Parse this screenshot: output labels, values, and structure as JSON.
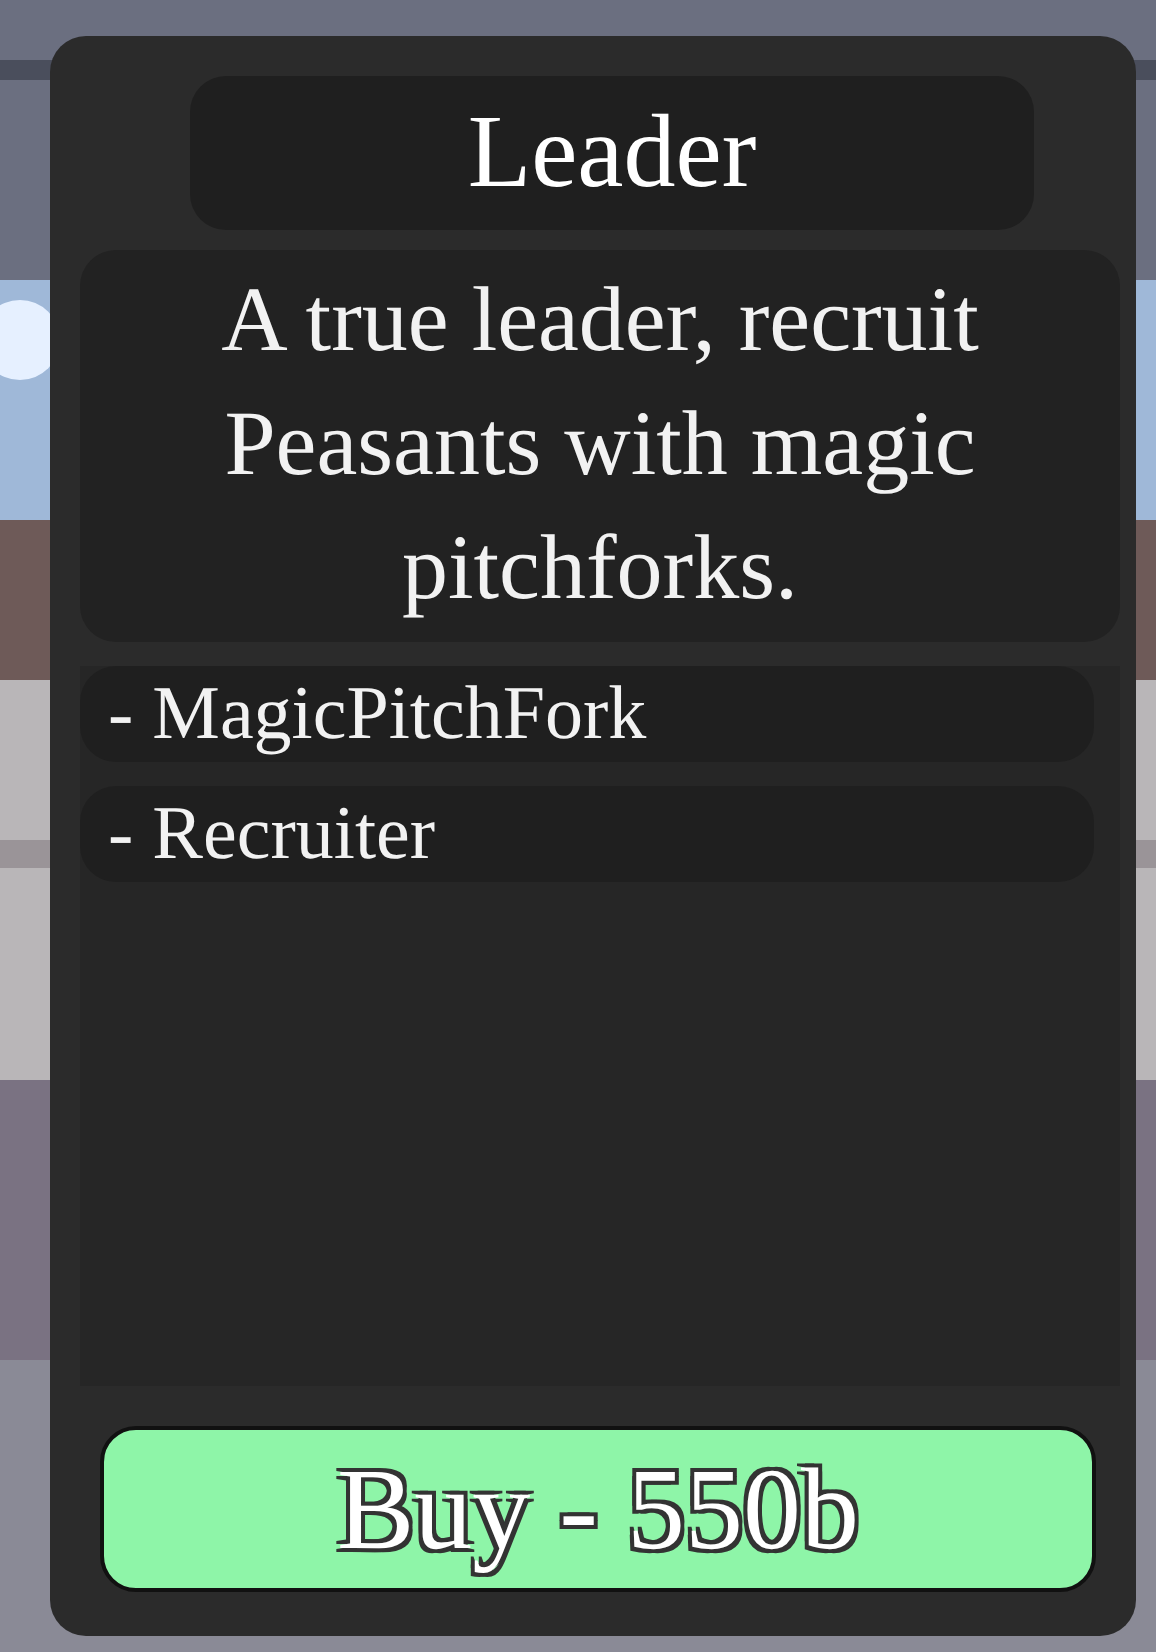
{
  "title": "Leader",
  "description": "A true leader, recruit Peasants with magic pitchforks.",
  "abilities": [
    "- MagicPitchFork",
    "- Recruiter"
  ],
  "buy_button": "Buy - 550b"
}
